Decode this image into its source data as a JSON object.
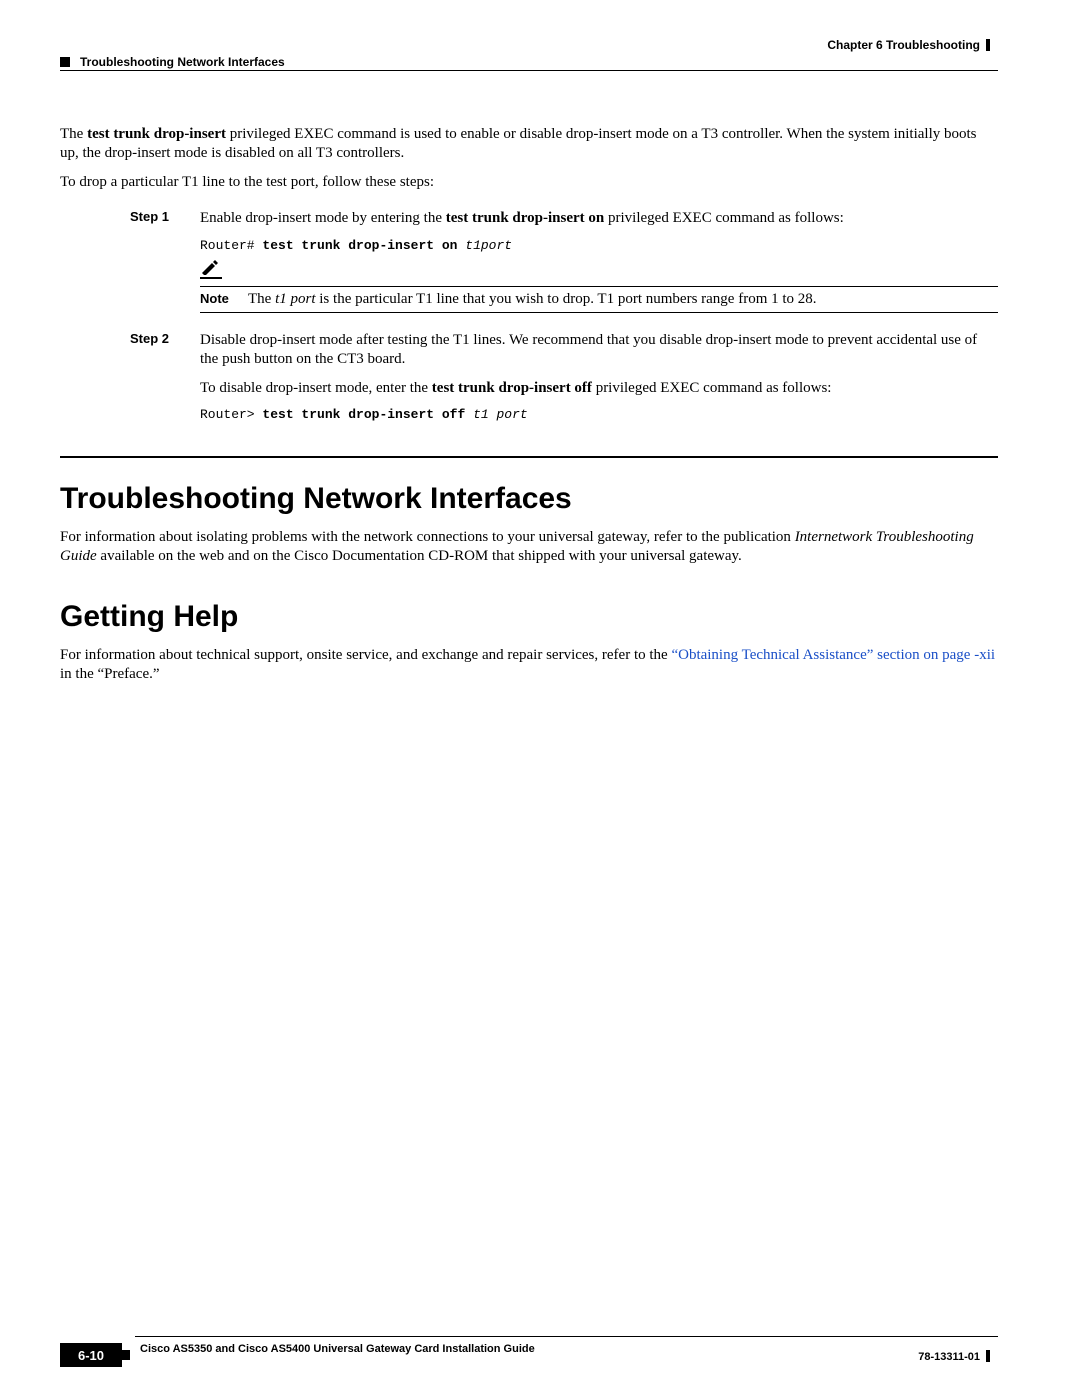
{
  "header": {
    "chapter": "Chapter 6    Troubleshooting",
    "section": "Troubleshooting Network Interfaces"
  },
  "intro": {
    "p1a": "The ",
    "p1b": "test trunk drop-insert",
    "p1c": " privileged EXEC command is used to enable or disable drop-insert mode on a T3 controller. When the system initially boots up, the drop-insert mode is disabled on all T3 controllers.",
    "p2": "To drop a particular T1 line to the test port, follow these steps:"
  },
  "step1": {
    "label": "Step 1",
    "t1": "Enable drop-insert mode by entering the ",
    "t2": "test trunk drop-insert on",
    "t3": " privileged EXEC command as follows:",
    "cli_prefix": "Router# ",
    "cli_cmd": "test trunk drop-insert on ",
    "cli_arg": "t1port",
    "note_label": "Note",
    "note_a": "The ",
    "note_b": "t1 port",
    "note_c": " is the particular T1 line that you wish to drop. T1 port numbers range from 1 to 28."
  },
  "step2": {
    "label": "Step 2",
    "p1": "Disable drop-insert mode after testing the T1 lines. We recommend that you disable drop-insert mode to prevent accidental use of the push button on the CT3 board.",
    "p2a": "To disable drop-insert mode, enter the ",
    "p2b": "test trunk drop-insert off",
    "p2c": " privileged EXEC command as follows:",
    "cli_prefix": "Router> ",
    "cli_cmd": "test trunk drop-insert off ",
    "cli_arg": "t1 port"
  },
  "sec1": {
    "title": "Troubleshooting Network Interfaces",
    "p_a": "For information about isolating problems with the network connections to your universal gateway, refer to the publication ",
    "p_b": "Internetwork Troubleshooting Guide",
    "p_c": " available on the web and on the Cisco Documentation CD-ROM that shipped with your universal gateway."
  },
  "sec2": {
    "title": "Getting Help",
    "p_a": "For information about technical support, onsite service, and exchange and repair services, refer to the ",
    "link": "“Obtaining Technical Assistance” section on page -xii",
    "p_b": " in the “Preface.”"
  },
  "footer": {
    "book": "Cisco AS5350 and Cisco AS5400 Universal Gateway Card Installation Guide",
    "page": "6-10",
    "doc": "78-13311-01"
  }
}
